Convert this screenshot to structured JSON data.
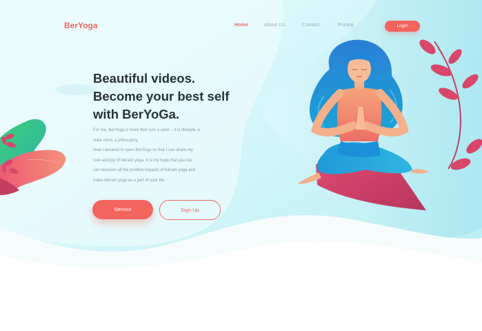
{
  "colors": {
    "accent": "#f2645e",
    "heading": "#263238",
    "body_text": "#8b98a3",
    "nav_text": "#9aa9b4",
    "sky_light": "#d8f6f9",
    "sky_mid": "#b6eef4",
    "hair_blue": "#1c8fd8",
    "mat": "#c43f5f"
  },
  "nav": {
    "logo": "BerYoga",
    "links": [
      {
        "label": "Home",
        "active": true
      },
      {
        "label": "About Us",
        "active": false
      },
      {
        "label": "Contact",
        "active": false
      },
      {
        "label": "Pricing",
        "active": false
      }
    ],
    "login_label": "Login"
  },
  "hero": {
    "title_lines": [
      "Beautiful videos.",
      "Become your best self",
      "with BerYoGa."
    ],
    "description_lines": [
      "For me, BerYoga is more than just a sport – it is lifestyle, a",
      "state mind, a philosophy.",
      "Now I decided to open BerYoga so that I can share my",
      "love and joy of bikram yoga. It is my hope that you too",
      "can discover all the positive impacts of bikram yoga and",
      "make bikram yoga as a part of your life."
    ],
    "primary_button": "Service",
    "secondary_button": "Sign Up"
  },
  "illustration": {
    "subject": "woman-meditating-icon",
    "decor": [
      "leaf-branch-icon",
      "plant-blob-icon"
    ]
  }
}
